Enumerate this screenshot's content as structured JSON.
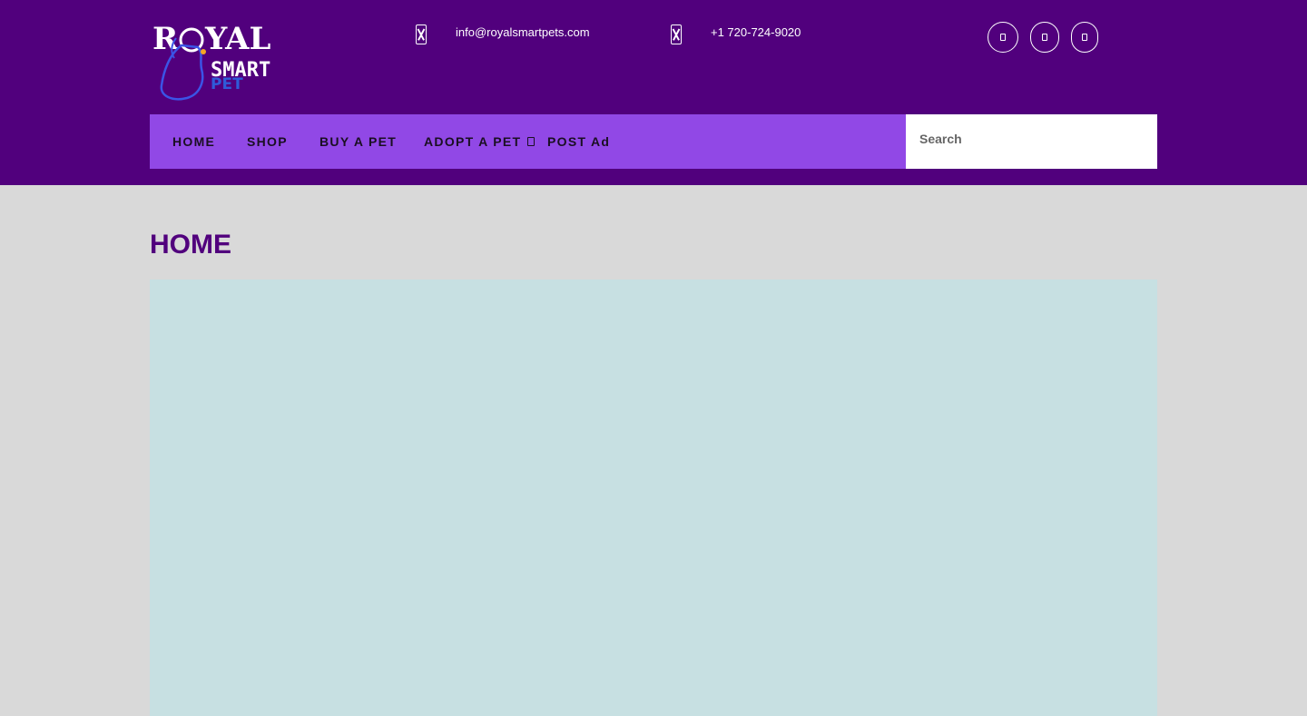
{
  "brand": {
    "logo_alt": "Royal Smart Pet",
    "logo_words": [
      "ROYAL",
      "SMART",
      "PET"
    ],
    "colors": {
      "header_bg": "#51007d",
      "nav_bg": "#9148e6",
      "title": "#51007d",
      "hero_bg": "#c7e0e2"
    }
  },
  "contact": {
    "email": "info@royalsmartpets.com",
    "email_icon": "envelope-icon",
    "phone": "+1 720-724-9020",
    "phone_icon": "phone-icon"
  },
  "social": [
    {
      "icon": "facebook-icon"
    },
    {
      "icon": "twitter-icon"
    },
    {
      "icon": "instagram-icon"
    }
  ],
  "nav": {
    "items": [
      "HOME",
      "SHOP",
      "BUY A PET",
      "ADOPT A PET",
      "POST Ad"
    ],
    "dropdown_icon": "chevron-down-icon"
  },
  "search": {
    "placeholder": "Search"
  },
  "page": {
    "title": "HOME"
  }
}
